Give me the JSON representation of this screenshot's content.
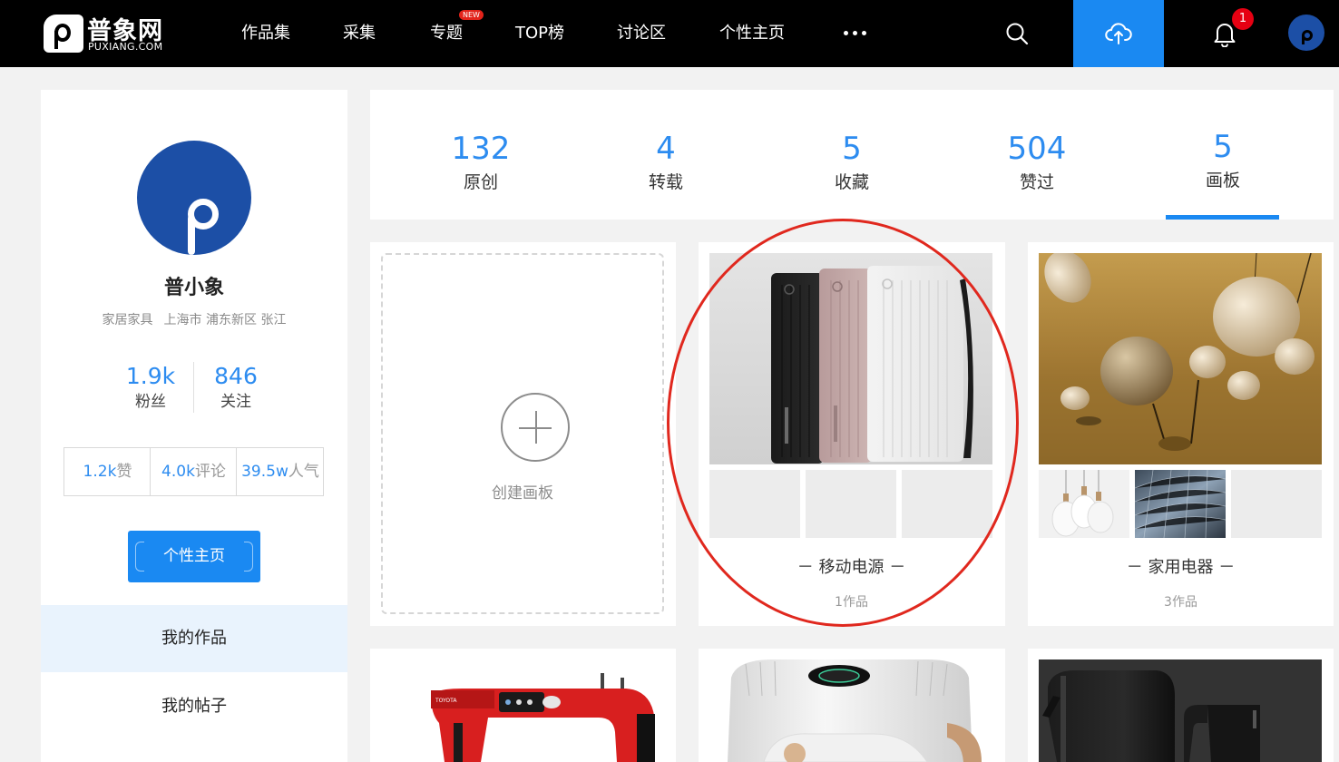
{
  "brand": {
    "name_cn": "普象网",
    "name_en": "PUXIANG.COM"
  },
  "nav": {
    "items": [
      {
        "label": "作品集"
      },
      {
        "label": "采集"
      },
      {
        "label": "专题",
        "badge": "NEW"
      },
      {
        "label": "TOP榜"
      },
      {
        "label": "讨论区"
      },
      {
        "label": "个性主页"
      }
    ],
    "more_icon": "more-dots-icon",
    "search_icon": "search-icon",
    "upload_icon": "cloud-upload-icon",
    "notification_count": "1",
    "accent_color": "#1a89f2"
  },
  "profile": {
    "name": "普小象",
    "category": "家居家具",
    "location": "上海市 浦东新区 张江",
    "followers": {
      "value": "1.9k",
      "label": "粉丝"
    },
    "following": {
      "value": "846",
      "label": "关注"
    },
    "likes": {
      "value": "1.2k",
      "label": "赞"
    },
    "comments": {
      "value": "4.0k",
      "label": "评论"
    },
    "popularity": {
      "value": "39.5w",
      "label": "人气"
    },
    "home_button": "个性主页"
  },
  "sidebar_menu": [
    {
      "label": "我的作品",
      "active": true
    },
    {
      "label": "我的帖子",
      "active": false
    }
  ],
  "stats": [
    {
      "value": "132",
      "label": "原创"
    },
    {
      "value": "4",
      "label": "转载"
    },
    {
      "value": "5",
      "label": "收藏"
    },
    {
      "value": "504",
      "label": "赞过"
    },
    {
      "value": "5",
      "label": "画板",
      "active": true
    }
  ],
  "create_board": {
    "label": "创建画板"
  },
  "boards": [
    {
      "title": "－ 移动电源 －",
      "count": "1作品"
    },
    {
      "title": "－ 家用电器 －",
      "count": "3作品"
    }
  ],
  "highlight_color": "#e0281e"
}
